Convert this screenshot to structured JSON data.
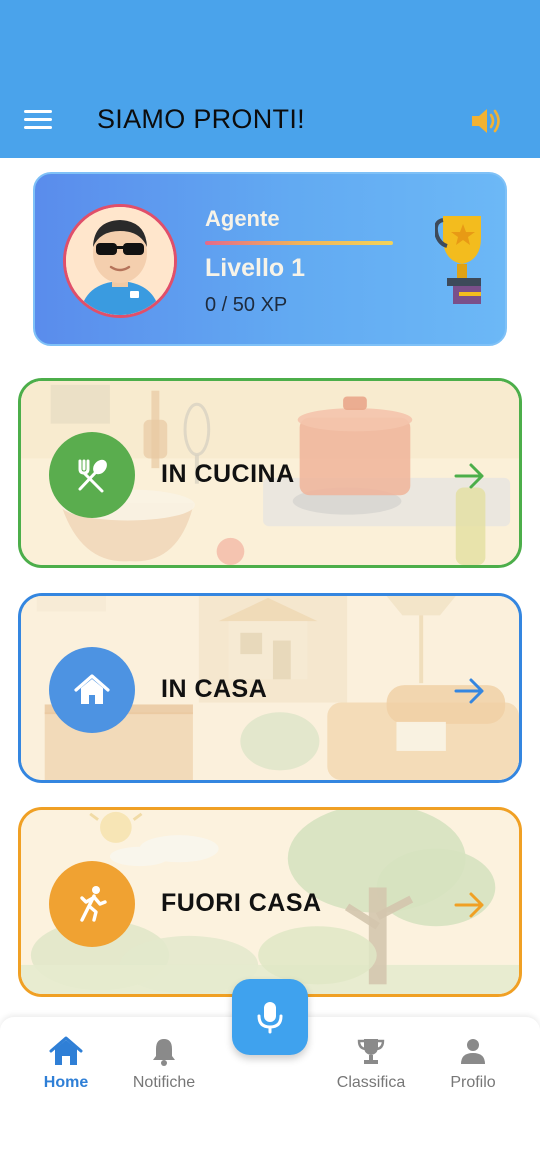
{
  "header": {
    "title": "SIAMO PRONTI!",
    "menu_icon": "menu-icon",
    "sound_icon": "volume-icon"
  },
  "profile": {
    "rank": "Agente",
    "level": "Livello 1",
    "xp": "0 / 50 XP",
    "xp_progress": 0
  },
  "categories": [
    {
      "label": "IN CUCINA",
      "icon": "fork-spoon-icon",
      "color": "#4cae4a"
    },
    {
      "label": "IN CASA",
      "icon": "house-icon",
      "color": "#3486e0"
    },
    {
      "label": "FUORI CASA",
      "icon": "running-person-icon",
      "color": "#f0a024"
    }
  ],
  "bottom_nav": {
    "items": [
      {
        "label": "Home",
        "icon": "home-icon",
        "active": true
      },
      {
        "label": "Notifiche",
        "icon": "bell-icon",
        "active": false
      },
      {
        "label": "Classifica",
        "icon": "trophy-icon",
        "active": false
      },
      {
        "label": "Profilo",
        "icon": "person-icon",
        "active": false
      }
    ],
    "center_icon": "microphone-icon"
  },
  "colors": {
    "appbar": "#4aa3eb",
    "accent": "#2f7fd6"
  }
}
